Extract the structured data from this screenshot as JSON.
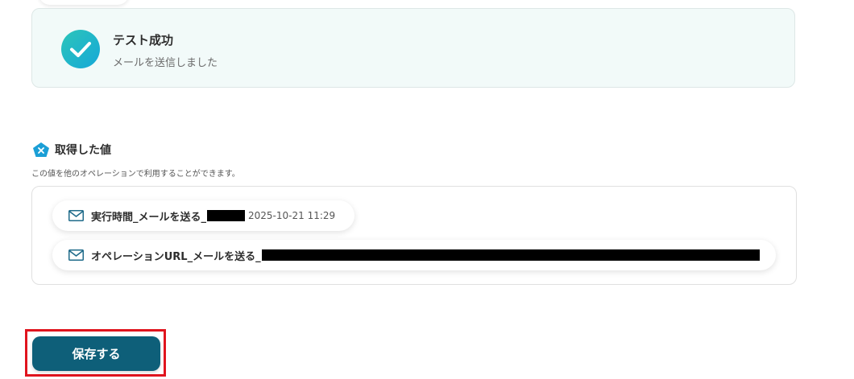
{
  "test_result": {
    "title": "テスト成功",
    "subtitle": "メールを送信しました",
    "icon": "check-circle-icon",
    "status_color": "#1fb8c9"
  },
  "acquired_values": {
    "title": "取得した値",
    "description": "この値を他のオペレーションで利用することができます。",
    "icon": "pentagon-x-icon",
    "items": [
      {
        "label": "実行時間_メールを送る_",
        "value": "2025-10-21 11:29",
        "icon": "mail-icon",
        "redacted": true
      },
      {
        "label": "オペレーションURL_メールを送る_",
        "value": "",
        "icon": "mail-icon",
        "redacted": true
      }
    ]
  },
  "actions": {
    "save_label": "保存する",
    "save_color": "#0e5f79",
    "highlight_color": "#e0141e"
  }
}
